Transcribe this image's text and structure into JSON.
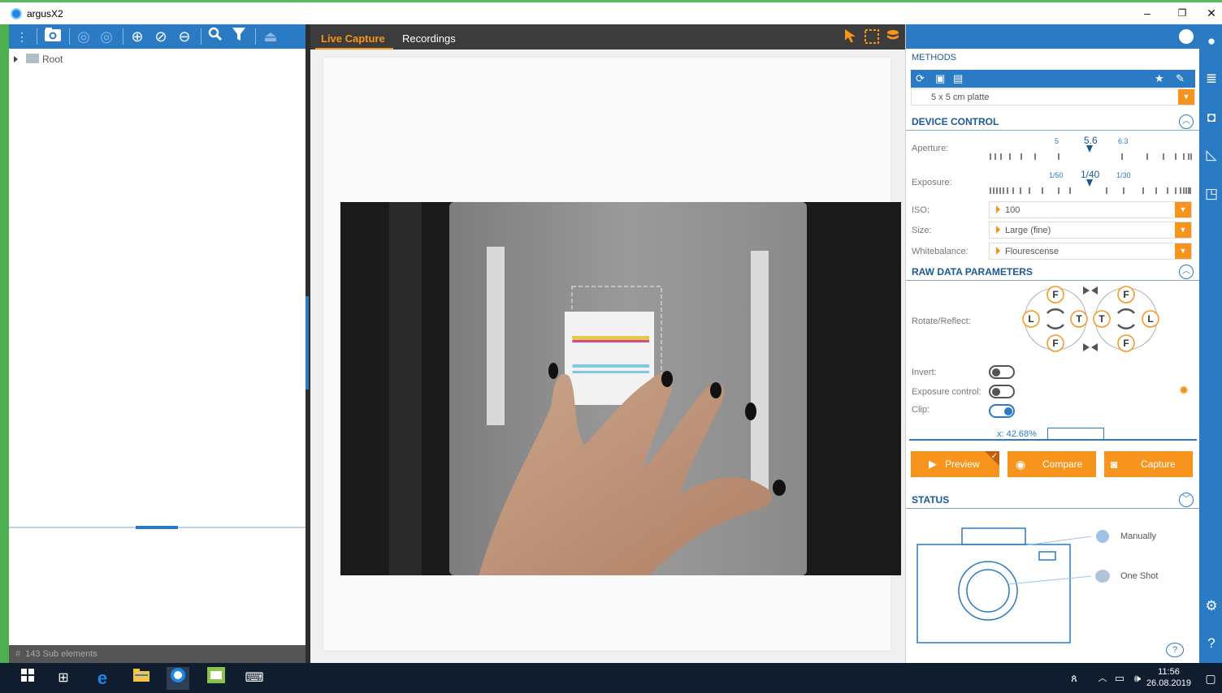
{
  "window": {
    "title": "argusX2",
    "minimize": "–",
    "restore": "❐",
    "close": "✕"
  },
  "tree": {
    "root_label": "Root"
  },
  "left_status": {
    "icon": "#",
    "text": "143  Sub elements"
  },
  "center": {
    "tabs": [
      {
        "label": "Live Capture",
        "active": true
      },
      {
        "label": "Recordings",
        "active": false
      }
    ]
  },
  "methods": {
    "heading": "METHODS",
    "selected": "5 x 5 cm platte"
  },
  "device_control": {
    "heading": "DEVICE CONTROL",
    "aperture": {
      "label": "Aperture:",
      "ticks": [
        "5",
        "5.6",
        "6.3"
      ],
      "value": "5.6"
    },
    "exposure": {
      "label": "Exposure:",
      "ticks": [
        "1/50",
        "1/40",
        "1/30"
      ],
      "value": "1/40"
    },
    "iso": {
      "label": "ISO:",
      "value": "100"
    },
    "size": {
      "label": "Size:",
      "value": "Large (fine)"
    },
    "whitebalance": {
      "label": "Whitebalance:",
      "value": "Flourescense"
    }
  },
  "raw_data": {
    "heading": "RAW DATA PARAMETERS",
    "rotate_label": "Rotate/Reflect:",
    "invert": {
      "label": "Invert:",
      "on": false
    },
    "exposure_control": {
      "label": "Exposure control:",
      "on": false
    },
    "clip": {
      "label": "Clip:",
      "on": true
    },
    "clip_x": "x: 42.68%"
  },
  "actions": {
    "preview": "Preview",
    "compare": "Compare",
    "capture": "Capture"
  },
  "status": {
    "heading": "STATUS",
    "manually": "Manually",
    "one_shot": "One Shot"
  },
  "taskbar": {
    "time": "11:56",
    "date": "26.08.2019"
  },
  "colors": {
    "accent_blue": "#2a7bc4",
    "accent_orange": "#f7941d"
  }
}
